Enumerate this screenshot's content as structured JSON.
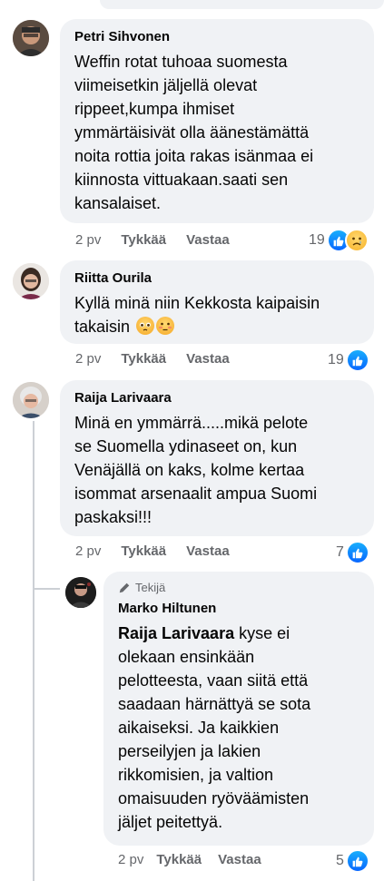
{
  "comments": [
    {
      "author": "Petri Sihvonen",
      "text": "Weffin rotat tuhoaa suomesta\nviimeisetkin jäljellä olevat\nrippeet,kumpa ihmiset\nymmärtäisivät olla äänestämättä\nnoita rottia joita rakas isänmaa ei\nkiinnosta vittuakaan.saati sen\nkansalaiset.",
      "age": "2 pv",
      "like_label": "Tykkää",
      "reply_label": "Vastaa",
      "reaction_count": "19",
      "reactions": [
        "like-icon",
        "sad-icon"
      ]
    },
    {
      "author": "Riitta Ourila",
      "text": "Kyllä minä niin Kekkosta kaipaisin\ntakaisin ",
      "emojis": [
        "pleading-face-emoji",
        "flushed-face-emoji"
      ],
      "age": "2 pv",
      "like_label": "Tykkää",
      "reply_label": "Vastaa",
      "reaction_count": "19",
      "reactions": [
        "like-icon"
      ]
    },
    {
      "author": "Raija Larivaara",
      "text": "Minä en ymmärrä.....mikä pelote\nse Suomella ydinaseet on, kun\nVenäjällä on kaks, kolme kertaa\nisommat arsenaalit ampua Suomi\npaskaksi!!!",
      "age": "2 pv",
      "like_label": "Tykkää",
      "reply_label": "Vastaa",
      "reaction_count": "7",
      "reactions": [
        "like-icon"
      ]
    }
  ],
  "reply": {
    "badge": "Tekijä",
    "author": "Marko Hiltunen",
    "mention": "Raija Larivaara",
    "text": " kyse ei\nolekaan ensinkään\npelotteesta, vaan siitä että\nsaadaan härnättyä se sota\naikaiseksi. Ja kaikkien\nperseilyjen ja lakien\nrikkomisien, ja valtion\nomaisuuden ryöväämisten\njäljet peitettyä.",
    "age": "2 pv",
    "like_label": "Tykkää",
    "reply_label": "Vastaa",
    "reaction_count": "5",
    "reactions": [
      "like-icon"
    ]
  },
  "colors": {
    "bubble": "#f0f2f5",
    "meta_text": "#65676b",
    "like_blue": "#0866ff",
    "thread_line": "#ccd0d5"
  }
}
